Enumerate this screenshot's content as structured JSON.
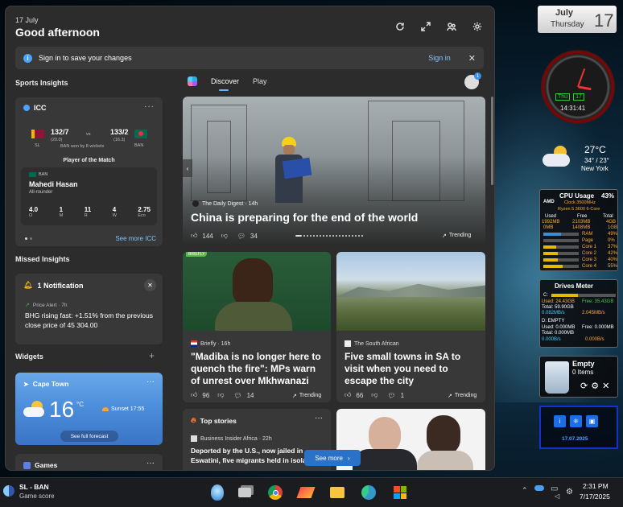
{
  "header": {
    "date": "17 July",
    "greeting": "Good afternoon"
  },
  "signin_bar": {
    "message": "Sign in to save your changes",
    "link": "Sign in"
  },
  "sports": {
    "section_title": "Sports Insights",
    "card_title": "ICC",
    "team1": {
      "code": "SL",
      "score": "132/7",
      "overs": "(20.0)"
    },
    "team2": {
      "code": "BAN",
      "score": "133/2",
      "overs": "(16.3)"
    },
    "vs": "vs",
    "result": "BAN won by 8 wickets",
    "potm_label": "Player of the Match",
    "player": {
      "team": "BAN",
      "name": "Mahedi Hasan",
      "role": "All-rounder"
    },
    "stats": [
      {
        "value": "4.0",
        "label": "O"
      },
      {
        "value": "1",
        "label": "M"
      },
      {
        "value": "11",
        "label": "R"
      },
      {
        "value": "4",
        "label": "W"
      },
      {
        "value": "2.75",
        "label": "Eco"
      }
    ],
    "see_more": "See more ICC"
  },
  "missed": {
    "section_title": "Missed Insights",
    "count_label": "1 Notification",
    "alert_source": "Price Alert · 7h",
    "alert_text": "BHG rising fast: +1.51% from the previous close price of 45 304.00"
  },
  "widgets": {
    "section_title": "Widgets",
    "add": "+",
    "weather": {
      "city": "Cape Town",
      "temp": "16",
      "unit": "°C",
      "sunset": "Sunset 17:55",
      "forecast_btn": "See full forecast"
    },
    "games_title": "Games"
  },
  "tabs": {
    "discover": "Discover",
    "play": "Play",
    "badge": "1"
  },
  "hero": {
    "source": "The Daily Digest · 14h",
    "title": "China is preparing for the end of the world",
    "likes": "144",
    "comments": "34",
    "trending": "Trending"
  },
  "card1": {
    "tag": "BRIEFLY",
    "source": "Briefly · 16h",
    "title": "\"Madiba is no longer here to quench the fire\": MPs warn of unrest over Mkhwanazi",
    "likes": "96",
    "comments": "14",
    "trending": "Trending"
  },
  "card2": {
    "source": "The South African",
    "title": "Five small towns in SA to visit when you need to escape the city",
    "likes": "66",
    "comments": "1",
    "trending": "Trending"
  },
  "top_stories": {
    "title": "Top stories",
    "source": "Business Insider Africa · 22h",
    "headline": "Deported by the U.S., now jailed in Eswatini, five migrants held in isolat"
  },
  "see_more_btn": "See more",
  "gadgets": {
    "month": "July",
    "weekday": "Thursday",
    "day": "17",
    "clock_day": "Thu",
    "clock_date": "17",
    "clock_time": "14:31:41",
    "wx_temp": "27°C",
    "wx_range": "34° / 23°",
    "wx_city": "New York",
    "cpu": {
      "title": "CPU Usage",
      "pct": "43%",
      "brand": "AMD",
      "clock": "Clock 3500MHz",
      "model": "Ryzen 5 3600 6-Core",
      "h_used": "Used",
      "h_free": "Free",
      "h_total": "Total",
      "r1": [
        "1992MB",
        "2103MB",
        "4GB"
      ],
      "r2": [
        "0MB",
        "1408MB",
        "1GB"
      ],
      "rows": [
        {
          "label": "RAM",
          "pct": "49%",
          "fill": 0.49,
          "color": "#3a8ed8"
        },
        {
          "label": "Page",
          "pct": "0%",
          "fill": 0.0,
          "color": "#3a8ed8"
        },
        {
          "label": "Core 1",
          "pct": "37%",
          "fill": 0.37,
          "color": "#e6b800"
        },
        {
          "label": "Core 2",
          "pct": "42%",
          "fill": 0.42,
          "color": "#e6b800"
        },
        {
          "label": "Core 3",
          "pct": "40%",
          "fill": 0.4,
          "color": "#e6b800"
        },
        {
          "label": "Core 4",
          "pct": "55%",
          "fill": 0.55,
          "color": "#e6b800"
        }
      ]
    },
    "drives": {
      "title": "Drives Meter",
      "c_label": "C:",
      "c_used": "Used: 24.43GB",
      "c_free": "Free: 35.43GB",
      "c_total": "Total: 59.90GB",
      "c_read": "0.082MB/s",
      "c_write": "2.045MB/s",
      "d_label": "D: EMPTY",
      "d_used": "Used: 0.000MB",
      "d_free": "Free: 0.000MB",
      "d_total": "Total: 0.000MB",
      "d_read": "0.000B/s",
      "d_write": "0.000B/s"
    },
    "recycle": {
      "title": "Empty",
      "items": "0 Items"
    },
    "security_date": "17.07.2025"
  },
  "taskbar": {
    "score_title": "SL - BAN",
    "score_sub": "Game score",
    "time": "2:31 PM",
    "date": "7/17/2025"
  }
}
